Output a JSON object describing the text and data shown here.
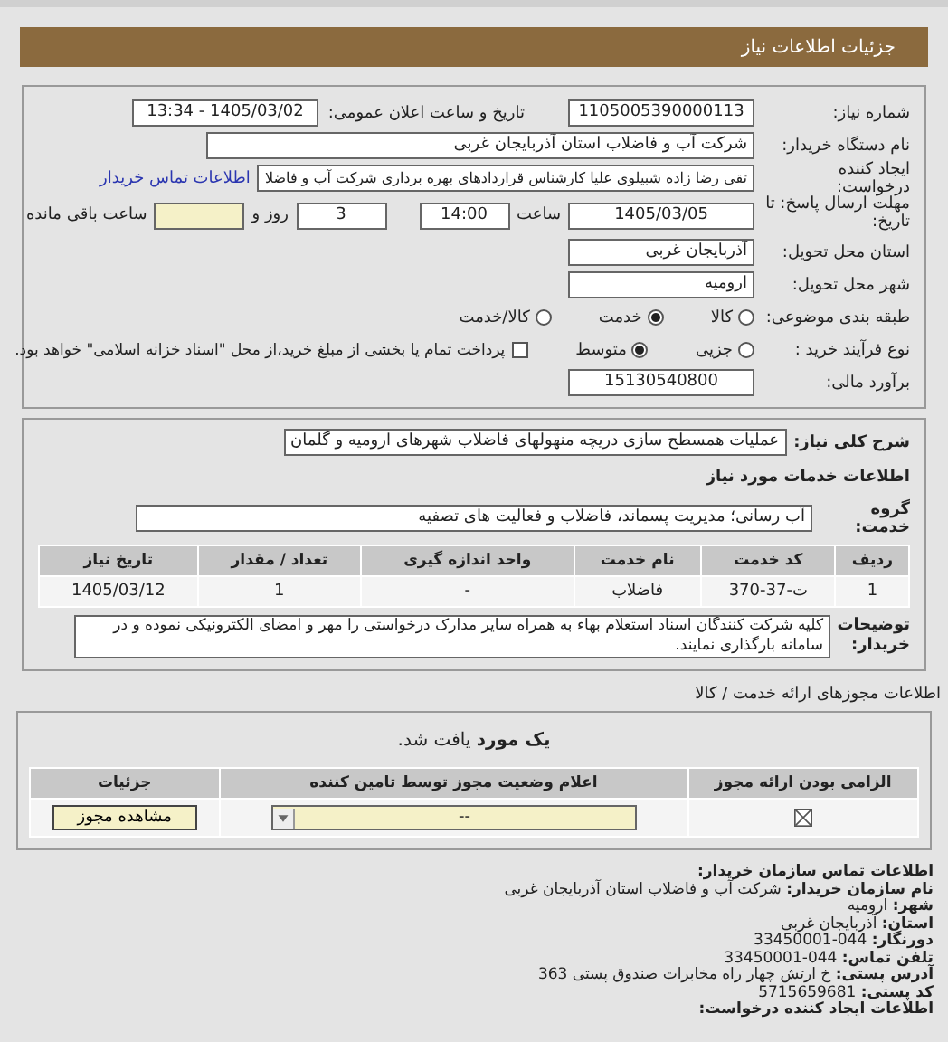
{
  "header": {
    "title": "جزئیات اطلاعات نیاز"
  },
  "need_number": {
    "label": "شماره نیاز:",
    "value": "1105005390000113"
  },
  "announce": {
    "label": "تاریخ و ساعت اعلان عمومی:",
    "value": "1405/03/02 - 13:34"
  },
  "buyer": {
    "label": "نام دستگاه خریدار:",
    "value": "شرکت آب و فاضلاب استان آذربایجان غربی"
  },
  "creator": {
    "label": "ایجاد کننده درخواست:",
    "value": "تقی رضا زاده شبیلوی علیا کارشناس قراردادهای بهره برداری شرکت آب و فاضلا",
    "link": "اطلاعات تماس خریدار"
  },
  "deadline": {
    "label": "مهلت ارسال پاسخ: تا تاریخ:",
    "date": "1405/03/05",
    "time_label": "ساعت",
    "time": "14:00",
    "days": "3",
    "days_label": "روز و",
    "hours_label": "ساعت باقی مانده"
  },
  "province": {
    "label": "استان محل تحویل:",
    "value": "آذربایجان غربی"
  },
  "city": {
    "label": "شهر محل تحویل:",
    "value": "ارومیه"
  },
  "category": {
    "label": "طبقه بندی موضوعی:",
    "options": [
      {
        "label": "کالا",
        "selected": false
      },
      {
        "label": "خدمت",
        "selected": true
      },
      {
        "label": "کالا/خدمت",
        "selected": false
      }
    ]
  },
  "process": {
    "label": "نوع فرآیند خرید :",
    "options": [
      {
        "label": "جزیی",
        "selected": false
      },
      {
        "label": "متوسط",
        "selected": true
      }
    ],
    "treasury": {
      "label": "پرداخت تمام یا بخشی از مبلغ خرید،از محل \"اسناد خزانه اسلامی\" خواهد بود.",
      "checked": false
    }
  },
  "budget": {
    "label": "برآورد مالی:",
    "value": "15130540800"
  },
  "description": {
    "label": "شرح کلی نیاز:",
    "value": "عملیات همسطح سازی دریچه منهولهای فاضلاب شهرهای ارومیه و گلمان"
  },
  "services_heading": "اطلاعات خدمات مورد نیاز",
  "service_group": {
    "label": "گروه خدمت:",
    "value": "آب رسانی؛ مدیریت پسماند، فاضلاب و فعالیت های تصفیه"
  },
  "services_table": {
    "columns": [
      "ردیف",
      "کد خدمت",
      "نام خدمت",
      "واحد اندازه گیری",
      "تعداد / مقدار",
      "تاریخ نیاز"
    ],
    "rows": [
      [
        "1",
        "ت-37-370",
        "فاضلاب",
        "-",
        "1",
        "1405/03/12"
      ]
    ]
  },
  "notes": {
    "label": "توضیحات خریدار:",
    "value": "کلیه شرکت کنندگان اسناد استعلام بهاء به همراه سایر مدارک درخواستی را مهر و امضای الکترونیکی نموده و در سامانه بارگذاری نمایند."
  },
  "licenses": {
    "title": "اطلاعات مجوزهای ارائه خدمت / کالا",
    "found": "**یک مورد** یافت شد.",
    "columns": [
      "الزامی بودن ارائه مجوز",
      "اعلام وضعیت مجوز توسط تامین کننده",
      "جزئیات"
    ],
    "rows": [
      {
        "required": true,
        "status": "--",
        "button": "مشاهده مجوز"
      }
    ]
  },
  "contact": {
    "title": "اطلاعات تماس سازمان خریدار:",
    "lines": [
      "**نام سازمان خریدار:** شرکت آب و فاضلاب استان آذربایجان غربی",
      "**شهر:** ارومیه",
      "**استان:** آذربایجان غربی",
      "**دورنگار:** 044-33450001",
      "**تلفن تماس:** 044-33450001",
      "**آدرس پستی:** خ ارتش چهار راه مخابرات صندوق پستی 363",
      "**کد پستی:** 5715659681"
    ],
    "footer": "اطلاعات ایجاد کننده درخواست:"
  }
}
